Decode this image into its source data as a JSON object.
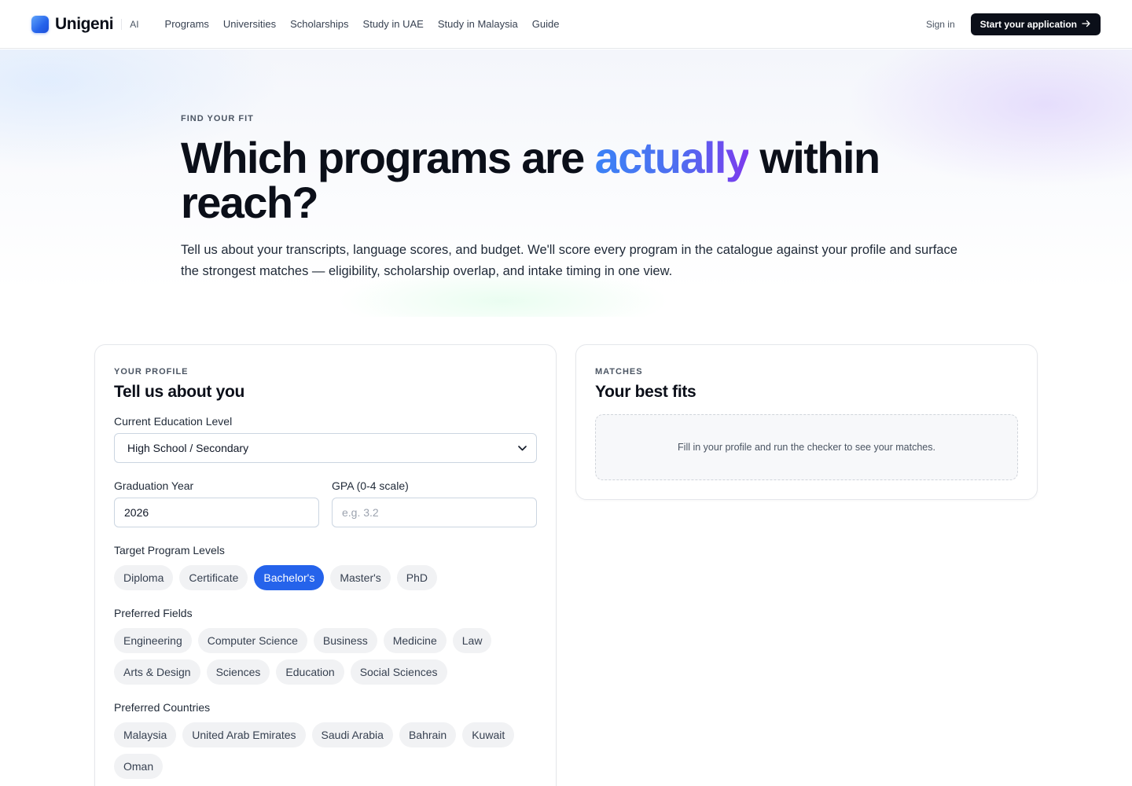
{
  "nav": {
    "brand": "Unigeni",
    "brand_tag": "AI",
    "links": [
      "Programs",
      "Universities",
      "Scholarships",
      "Study in UAE",
      "Study in Malaysia",
      "Guide"
    ],
    "sign_in": "Sign in",
    "cta": "Start your application",
    "cta_icon": "arrow-right-icon"
  },
  "hero": {
    "eyebrow": "FIND YOUR FIT",
    "title_before": "Which programs are ",
    "title_accent": "actually",
    "title_after": " within reach?",
    "subtitle": "Tell us about your transcripts, language scores, and budget. We'll score every program in the catalogue against your profile and surface the strongest matches — eligibility, scholarship overlap, and intake timing in one view.",
    "accent_gradient": [
      "#3b82f6",
      "#7c3aed"
    ]
  },
  "profile": {
    "eyebrow": "YOUR PROFILE",
    "title": "Tell us about you",
    "education": {
      "label": "Current Education Level",
      "value": "High School / Secondary"
    },
    "graduation": {
      "label": "Graduation Year",
      "value": "2026"
    },
    "gpa": {
      "label": "GPA (0-4 scale)",
      "placeholder": "e.g. 3.2"
    },
    "levels": {
      "label": "Target Program Levels",
      "options": [
        "Diploma",
        "Certificate",
        "Bachelor's",
        "Master's",
        "PhD"
      ],
      "selected": "Bachelor's"
    },
    "fields": {
      "label": "Preferred Fields",
      "row1": [
        "Engineering",
        "Computer Science",
        "Business",
        "Medicine",
        "Law"
      ],
      "row2": [
        "Arts & Design",
        "Sciences",
        "Education",
        "Social Sciences"
      ]
    },
    "countries": {
      "label": "Preferred Countries",
      "row1": [
        "Malaysia",
        "United Arab Emirates",
        "Saudi Arabia",
        "Bahrain",
        "Kuwait"
      ],
      "row2": [
        "Oman"
      ]
    }
  },
  "matches": {
    "eyebrow": "MATCHES",
    "title": "Your best fits",
    "empty": "Fill in your profile and run the checker to see your matches."
  },
  "colors": {
    "primary": "#2563eb",
    "dark": "#0b0f19",
    "chip_bg": "#f1f2f4"
  }
}
